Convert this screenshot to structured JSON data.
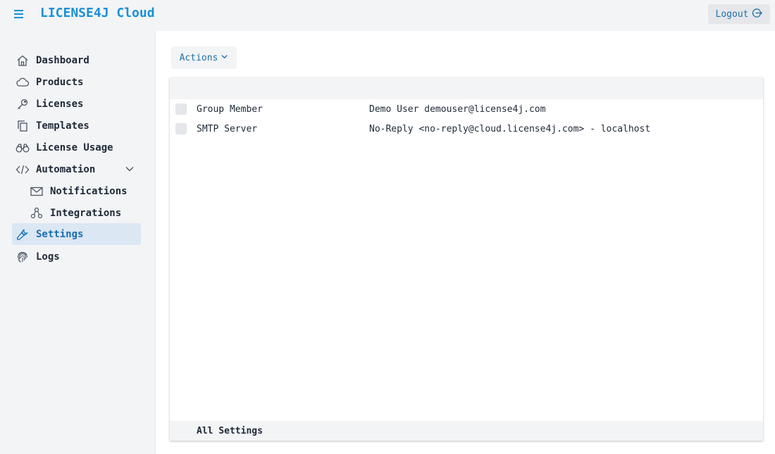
{
  "header": {
    "brand": "LICENSE4J Cloud",
    "logout_label": "Logout"
  },
  "sidebar": {
    "items": [
      {
        "label": "Dashboard",
        "icon": "home-icon"
      },
      {
        "label": "Products",
        "icon": "cloud-icon"
      },
      {
        "label": "Licenses",
        "icon": "key-icon"
      },
      {
        "label": "Templates",
        "icon": "copy-icon"
      },
      {
        "label": "License Usage",
        "icon": "binoculars-icon"
      },
      {
        "label": "Automation",
        "icon": "code-icon"
      },
      {
        "label": "Notifications",
        "icon": "envelope-icon"
      },
      {
        "label": "Integrations",
        "icon": "diagram-icon"
      },
      {
        "label": "Settings",
        "icon": "wrench-icon"
      },
      {
        "label": "Logs",
        "icon": "fingerprint-icon"
      }
    ],
    "active": "Settings"
  },
  "main": {
    "actions_label": "Actions",
    "rows": [
      {
        "name": "Group Member",
        "value": "Demo User demouser@license4j.com"
      },
      {
        "name": "SMTP Server",
        "value": "No-Reply <no-reply@cloud.license4j.com> - localhost"
      }
    ],
    "footer": "All Settings"
  },
  "colors": {
    "accent": "#1a8fd8",
    "active_bg": "#dbe7f3",
    "background": "#f3f4f6"
  }
}
